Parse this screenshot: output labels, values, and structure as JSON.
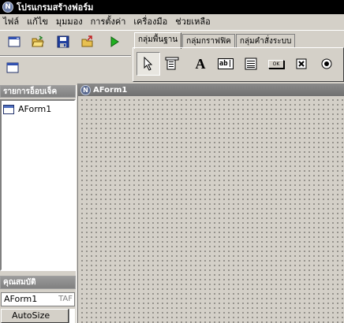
{
  "window": {
    "title": "โปรแกรมสร้างฟอร์ม",
    "icon": "app-logo-icon"
  },
  "menu": [
    "ไฟล์",
    "แก้ไข",
    "มุมมอง",
    "การตั้งค่า",
    "เครื่องมือ",
    "ช่วยเหลือ"
  ],
  "toolbar": {
    "buttons": [
      "new-form-icon",
      "open-folder-icon",
      "save-icon",
      "export-icon",
      "run-icon",
      "form-window-icon"
    ]
  },
  "palette": {
    "tabs": [
      "กลุ่มพื้นฐาน",
      "กลุ่มกราฟฟิค",
      "กลุ่มคำสั่งระบบ"
    ],
    "active_tab": 0,
    "tools": [
      "pointer-icon",
      "menu-tool-icon",
      "label-tool-icon",
      "textbox-tool-icon",
      "memo-tool-icon",
      "button-tool-icon",
      "checkbox-tool-icon",
      "radio-tool-icon"
    ],
    "button_caption": "OK",
    "label_glyph": "A",
    "textbox_glyph": "ab|"
  },
  "object_panel": {
    "title": "รายการอ็อบเจ็ค",
    "items": [
      "AForm1"
    ]
  },
  "property_panel": {
    "title": "คุณสมบัติ",
    "selected_object": "AForm1",
    "selected_type": "TAF",
    "rows": [
      "AutoSize"
    ]
  },
  "form_designer": {
    "caption": "AForm1"
  }
}
